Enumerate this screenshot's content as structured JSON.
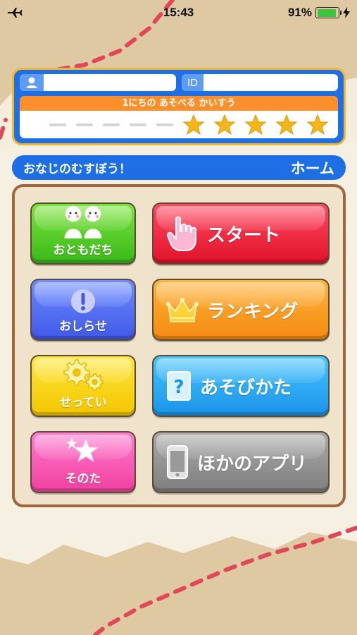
{
  "status_bar": {
    "time": "15:43",
    "battery_text": "91%",
    "battery_level": 0.91,
    "left_icon": "airplane-icon",
    "right_icon": "charging-bolt-icon"
  },
  "profile": {
    "user_icon": "user-icon",
    "name_value": "",
    "id_tag": "ID",
    "id_value": "",
    "plays_header": "1にちの あそべる かいすう",
    "stars_filled": 5,
    "dash_count": 5
  },
  "title_bar": {
    "title": "おなじのむすぼう！",
    "home_label": "ホーム"
  },
  "menu": {
    "friends_label": "おともだち",
    "news_label": "おしらせ",
    "settings_label": "せってい",
    "other_label": "そのた",
    "start_label": "スタート",
    "ranking_label": "ランキング",
    "howto_label": "あそびかた",
    "other_apps_label": "ほかのアプリ"
  },
  "colors": {
    "frame_blue": "#1e6fe6",
    "frame_gold": "#f2b628",
    "panel_brown": "#a2653c",
    "star_gold": "#f4b619",
    "dotted_line": "#e0485a"
  }
}
